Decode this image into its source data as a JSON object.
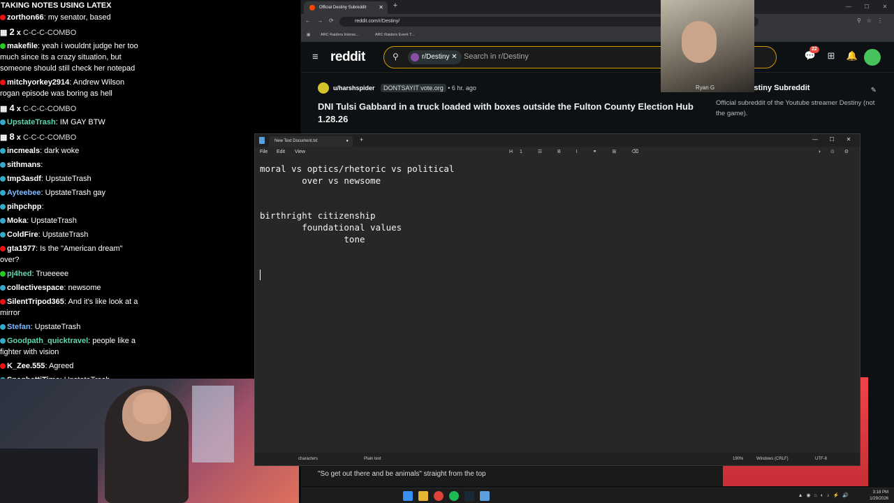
{
  "chat": {
    "title": "TAKING NOTES USING LATEX",
    "messages": [
      {
        "type": "msg",
        "badge": "#e11",
        "user": "zorthon66",
        "ucolor": "#ffffff",
        "text": "my senator, based"
      },
      {
        "type": "combo",
        "count": "2",
        "mult": "x",
        "text": "C-C-C-COMBO"
      },
      {
        "type": "msg",
        "badge": "#2c2",
        "user": "makefile",
        "ucolor": "#ffffff",
        "text": "yeah i wouldnt judge her too much since its a crazy situation, but someone should still check her notepad"
      },
      {
        "type": "msg",
        "badge": "#e11",
        "user": "mitchyorkey2914",
        "ucolor": "#ffffff",
        "text": "Andrew Wilson rogan episode was boring as hell"
      },
      {
        "type": "combo",
        "count": "4",
        "mult": "x",
        "text": "C-C-C-COMBO"
      },
      {
        "type": "msg",
        "badge": "#3ac",
        "user": "UpstateTrash",
        "ucolor": "#5fd8b0",
        "text": "IM GAY BTW"
      },
      {
        "type": "combo",
        "count": "8",
        "mult": "x",
        "text": "C-C-C-COMBO"
      },
      {
        "type": "msg",
        "badge": "#3ac",
        "user": "incmeals",
        "ucolor": "#ffffff",
        "text": "dark woke"
      },
      {
        "type": "msg",
        "badge": "#3ac",
        "user": "sithmans",
        "ucolor": "#ffffff",
        "text": ""
      },
      {
        "type": "msg",
        "badge": "#3ac",
        "user": "tmp3asdf",
        "ucolor": "#ffffff",
        "text": "UpstateTrash"
      },
      {
        "type": "msg",
        "badge": "#3ac",
        "user": "Ayteebee",
        "ucolor": "#7ab8ff",
        "text": "UpstateTrash  gay"
      },
      {
        "type": "msg",
        "badge": "#3ac",
        "user": "pihpchpp",
        "ucolor": "#ffffff",
        "text": ""
      },
      {
        "type": "msg",
        "badge": "#3ac",
        "user": "Moka",
        "ucolor": "#ffffff",
        "text": "UpstateTrash"
      },
      {
        "type": "msg",
        "badge": "#3ac",
        "user": "ColdFire",
        "ucolor": "#ffffff",
        "text": "UpstateTrash"
      },
      {
        "type": "msg",
        "badge": "#e11",
        "user": "gta1977",
        "ucolor": "#ffffff",
        "text": "Is the \"American dream\" over?"
      },
      {
        "type": "msg",
        "badge": "#2c2",
        "user": "pj4hed",
        "ucolor": "#5fd8b0",
        "text": "Trueeeee"
      },
      {
        "type": "msg",
        "badge": "#3ac",
        "user": "collectivespace",
        "ucolor": "#ffffff",
        "text": "newsome"
      },
      {
        "type": "msg",
        "badge": "#e11",
        "user": "SilentTripod365",
        "ucolor": "#ffffff",
        "text": "And it's like look at a mirror"
      },
      {
        "type": "msg",
        "badge": "#3ac",
        "user": "Stefan",
        "ucolor": "#7ab8ff",
        "text": "UpstateTrash"
      },
      {
        "type": "msg",
        "badge": "#3ac",
        "user": "Goodpath_quicktravel",
        "ucolor": "#5fd8b0",
        "text": "people like a fighter with vision"
      },
      {
        "type": "msg",
        "badge": "#e11",
        "user": "K_Zee.555",
        "ucolor": "#ffffff",
        "text": "Agreed"
      },
      {
        "type": "msg",
        "badge": "#3ac",
        "user": "SpaghettiTime",
        "ucolor": "#ffffff",
        "text": "UpstateTrash"
      }
    ]
  },
  "browser": {
    "tab_title": "Official Destiny Subreddit",
    "url": "reddit.com/r/Destiny/",
    "bookmarks": [
      "ARC Raiders Interac...",
      "ARC Raiders Event T..."
    ],
    "logo_text": "reddit",
    "search_chip": "r/Destiny",
    "search_placeholder": "Search in r/Destiny",
    "chat_badge": "22",
    "cam_label": "Ryan G",
    "post": {
      "user": "u/harshspider",
      "flair": "DONTSAYIT vote.org",
      "time": "• 6 hr. ago",
      "title": "DNI Tulsi Gabbard in a truck loaded with boxes outside the Fulton County Election Hub 1.28.26"
    },
    "sidebar": {
      "title": "Official Destiny Subreddit",
      "desc": "Official subreddit of the Youtube streamer Destiny (not the game)."
    },
    "caption": "\"So get out there and be animals\" straight from the top"
  },
  "notepad": {
    "tab_title": "New Text Document.txt",
    "menu": [
      "File",
      "Edit",
      "View"
    ],
    "content": "moral vs optics/rhetoric vs political\n        over vs newsome\n\n\nbirthright citizenship\n        foundational values\n                tone\n\n\n",
    "status": {
      "chars": "characters",
      "format": "Plain text",
      "zoom": "190%",
      "eol": "Windows (CRLF)",
      "enc": "UTF-8"
    }
  },
  "taskbar": {
    "time": "3:18 PM",
    "date": "1/29/2026"
  }
}
